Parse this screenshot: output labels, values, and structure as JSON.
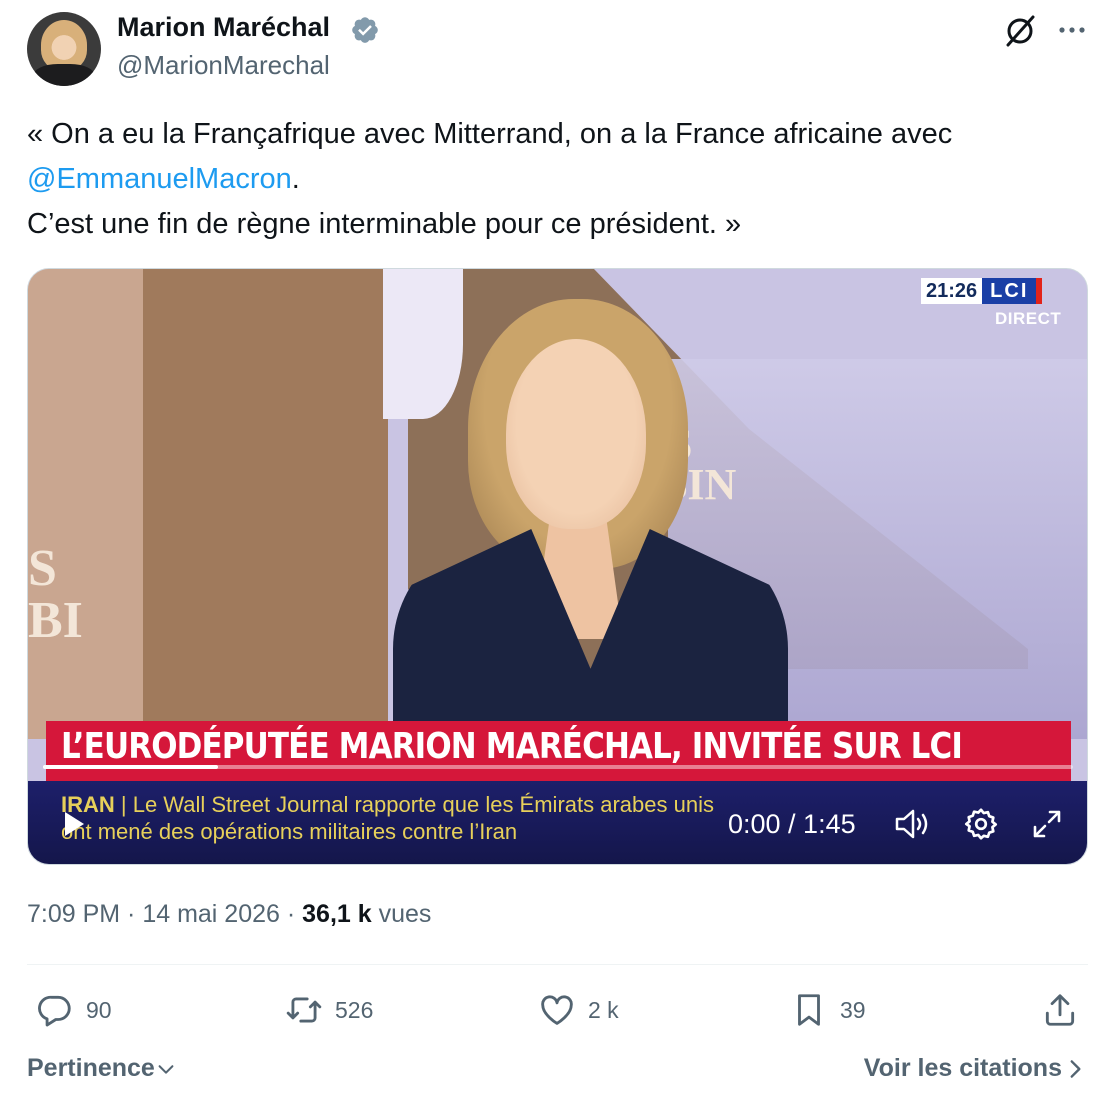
{
  "author": {
    "name": "Marion Maréchal",
    "handle": "@MarionMarechal",
    "verified": true
  },
  "tweet": {
    "text_part1": "« On a eu la Françafrique avec Mitterrand, on a la France africaine avec",
    "mention": "@EmmanuelMacron",
    "text_part2": ".",
    "text_part3": "C’est une fin de règne interminable pour ce président. »"
  },
  "video": {
    "wall_text_1": "S",
    "wall_text_2": "BIN",
    "wall_text_3": "S",
    "wall_text_4": "BI",
    "clock": "21:26",
    "channel_logo": "LCI",
    "live_label": "DIRECT",
    "banner_headline": "L’EURODÉPUTÉE MARION MARÉCHAL, INVITÉE SUR LCI",
    "ticker_tag": "IRAN",
    "ticker_line1": " | Le Wall Street Journal rapporte que les Émirats arabes unis",
    "ticker_line2": "ont mené des opérations militaires contre l’Iran",
    "time_readout": "0:00 / 1:45",
    "progress_fraction": 0.17
  },
  "meta": {
    "time": "7:09 PM",
    "separator": " · ",
    "date": "14 mai 2026",
    "views_count": "36,1 k",
    "views_label": " vues"
  },
  "actions": {
    "replies": "90",
    "retweets": "526",
    "likes": "2 k",
    "bookmarks": "39"
  },
  "footer": {
    "sort_label": "Pertinence",
    "quotes_label": "Voir les citations"
  },
  "colors": {
    "link": "#1d9bf0",
    "verified": "#829aab",
    "banner_red": "#d5173a",
    "ticker_yellow": "#e7d05a"
  }
}
